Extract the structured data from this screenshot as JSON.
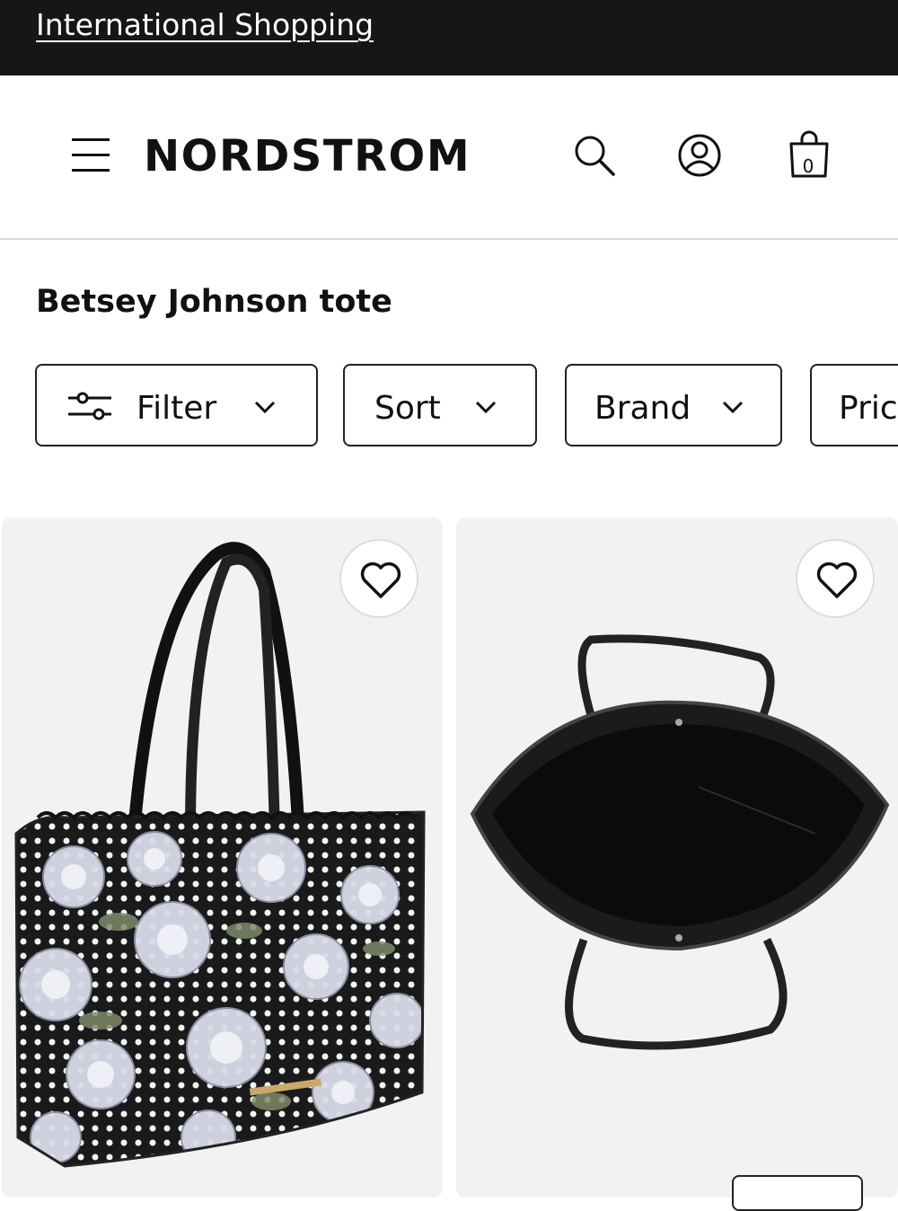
{
  "top_banner": {
    "link_label": "International Shopping"
  },
  "header": {
    "logo": "NORDSTROM",
    "bag_count": "0"
  },
  "search": {
    "query": "Betsey Johnson tote"
  },
  "filters": {
    "chips": [
      {
        "label": "Filter",
        "icon": "sliders-icon"
      },
      {
        "label": "Sort"
      },
      {
        "label": "Brand"
      },
      {
        "label": "Pric"
      }
    ]
  },
  "products": [
    {
      "image": "floral-tote-bag",
      "favorite": false
    },
    {
      "image": "black-tote-interior",
      "favorite": false
    }
  ],
  "colors": {
    "banner_bg": "#161616",
    "card_bg": "#f2f2f2",
    "text": "#111111"
  }
}
